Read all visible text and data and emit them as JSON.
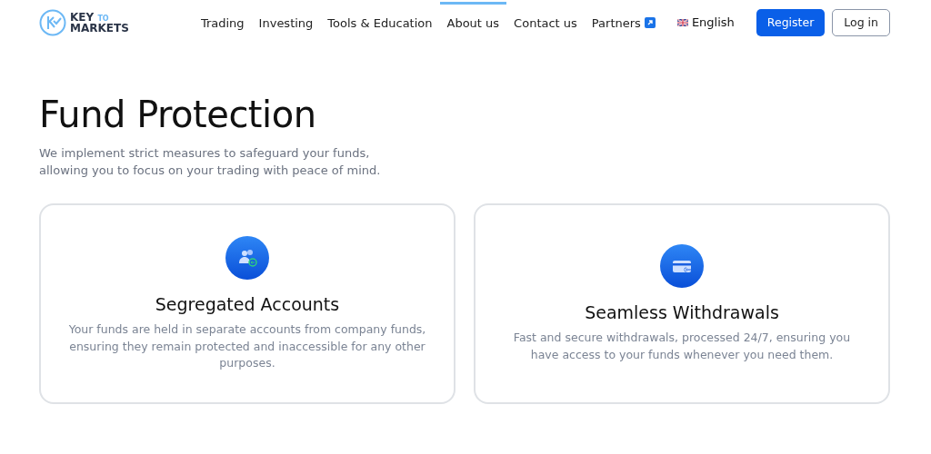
{
  "logo": {
    "word_1": "KEY",
    "word_2": "TO",
    "word_3": "MARKETS"
  },
  "nav": [
    {
      "label": "Trading",
      "selected": false
    },
    {
      "label": "Investing",
      "selected": false
    },
    {
      "label": "Tools & Education",
      "selected": false
    },
    {
      "label": "About us",
      "selected": true
    },
    {
      "label": "Contact us",
      "selected": false
    },
    {
      "label": "Partners",
      "selected": false,
      "external": true
    }
  ],
  "language": "English",
  "buttons": [
    {
      "label": "Register",
      "kind": "primary"
    },
    {
      "label": "Log in",
      "kind": "outline"
    }
  ],
  "heading": "Fund Protection",
  "intro": [
    "We implement strict measures to safeguard your funds,",
    "allowing you to focus on your trading with peace of mind."
  ],
  "cards": [
    {
      "kind": "people",
      "title": "Segregated Accounts",
      "text": "Your funds are held in separate accounts from company funds, ensuring they remain protected and inaccessible for any other purposes."
    },
    {
      "kind": "card",
      "title": "Seamless Withdrawals",
      "text": "Fast and secure withdrawals, processed 24/7, ensuring you have access to your funds whenever you need them."
    }
  ]
}
